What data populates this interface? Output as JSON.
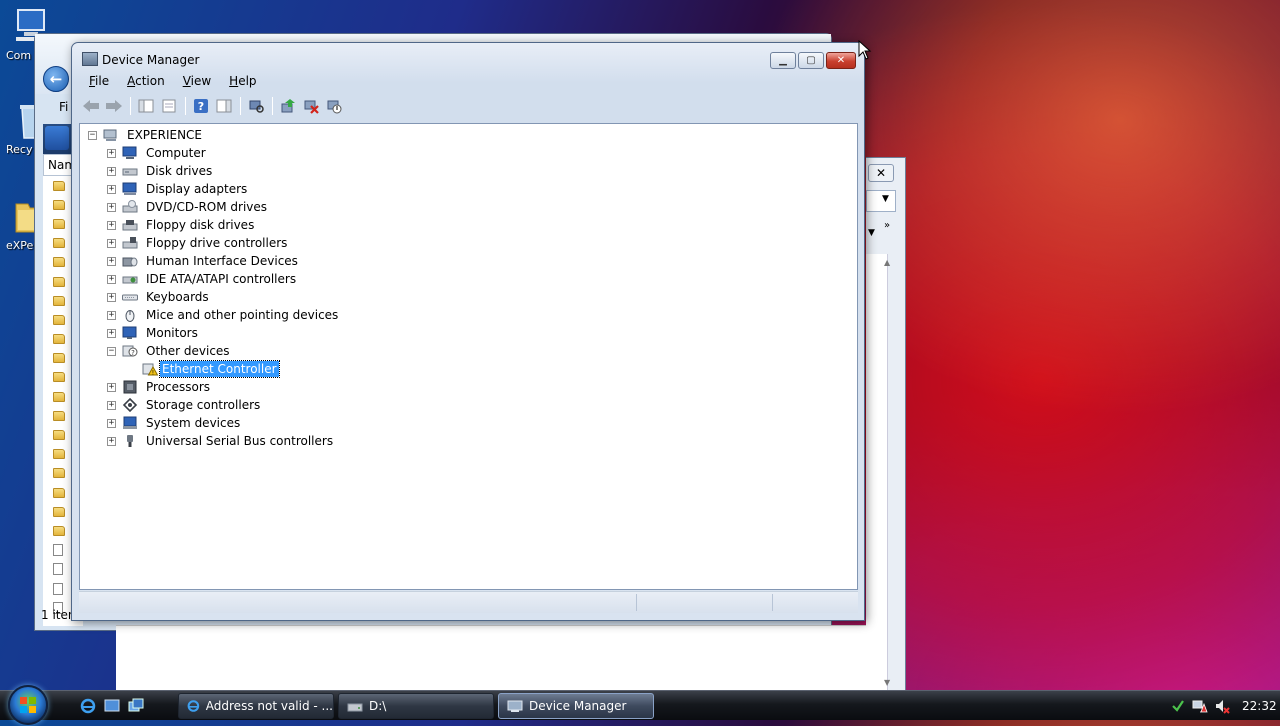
{
  "desktop": {
    "icons": [
      {
        "label": "Com",
        "icon": "computer-icon"
      },
      {
        "label": "Recy",
        "icon": "recycle-bin-icon"
      },
      {
        "label": "eXPe",
        "icon": "folder-icon"
      }
    ]
  },
  "explorer_bg": {
    "menu_label": "Fi",
    "column_header": "Nam",
    "status_text": "1 iten"
  },
  "window": {
    "title": "Device Manager",
    "controls": {
      "minimize": "minimize-button",
      "maximize": "maximize-button",
      "close": "close-button"
    }
  },
  "menu": [
    {
      "label": "File",
      "accel": "F",
      "rest": "ile"
    },
    {
      "label": "Action",
      "accel": "A",
      "rest": "ction"
    },
    {
      "label": "View",
      "accel": "V",
      "rest": "iew"
    },
    {
      "label": "Help",
      "accel": "H",
      "rest": "elp"
    }
  ],
  "toolbar": [
    "back-arrow-icon",
    "forward-arrow-icon",
    "show-hide-console-tree-icon",
    "properties-icon",
    "help-icon",
    "action-pane-icon",
    "scan-hardware-changes-icon",
    "update-driver-icon",
    "uninstall-icon",
    "disable-device-icon"
  ],
  "tree": {
    "root": "EXPERIENCE",
    "categories": [
      {
        "label": "Computer",
        "icon": "computer-icon"
      },
      {
        "label": "Disk drives",
        "icon": "disk-drive-icon"
      },
      {
        "label": "Display adapters",
        "icon": "display-adapter-icon"
      },
      {
        "label": "DVD/CD-ROM drives",
        "icon": "dvd-drive-icon"
      },
      {
        "label": "Floppy disk drives",
        "icon": "floppy-disk-icon"
      },
      {
        "label": "Floppy drive controllers",
        "icon": "floppy-controller-icon"
      },
      {
        "label": "Human Interface Devices",
        "icon": "hid-icon"
      },
      {
        "label": "IDE ATA/ATAPI controllers",
        "icon": "ide-controller-icon"
      },
      {
        "label": "Keyboards",
        "icon": "keyboard-icon"
      },
      {
        "label": "Mice and other pointing devices",
        "icon": "mouse-icon"
      },
      {
        "label": "Monitors",
        "icon": "monitor-icon"
      },
      {
        "label": "Other devices",
        "icon": "unknown-device-icon",
        "expanded": true
      },
      {
        "label": "Ethernet Controller",
        "icon": "warning-device-icon",
        "child": true,
        "selected": true
      },
      {
        "label": "Processors",
        "icon": "processor-icon"
      },
      {
        "label": "Storage controllers",
        "icon": "storage-controller-icon"
      },
      {
        "label": "System devices",
        "icon": "system-devices-icon"
      },
      {
        "label": "Universal Serial Bus controllers",
        "icon": "usb-icon"
      }
    ]
  },
  "taskbar": {
    "buttons": [
      {
        "label": "Address not valid - ...",
        "icon": "internet-explorer-icon"
      },
      {
        "label": "D:\\",
        "icon": "drive-icon"
      },
      {
        "label": "Device Manager",
        "icon": "device-manager-icon",
        "active": true
      }
    ],
    "tray_icons": [
      "network-icon",
      "network-warning-icon",
      "volume-muted-icon"
    ],
    "clock": "22:32"
  },
  "colors": {
    "selection": "#3399ff",
    "close_button": "#c9402f",
    "taskbar": "#15181d"
  }
}
